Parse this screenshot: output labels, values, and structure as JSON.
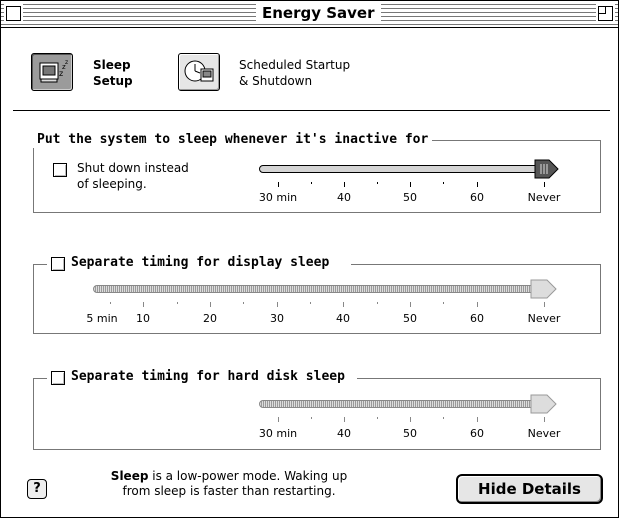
{
  "window": {
    "title": "Energy Saver"
  },
  "tabs": [
    {
      "label_line1": "Sleep",
      "label_line2": "Setup",
      "icon": "sleep-computer-icon",
      "selected": true
    },
    {
      "label_line1": "Scheduled Startup",
      "label_line2": "& Shutdown",
      "icon": "clock-computer-icon",
      "selected": false
    }
  ],
  "system_sleep": {
    "title": "Put the system to sleep whenever it's inactive for",
    "shutdown_label_line1": "Shut down instead",
    "shutdown_label_line2": "of sleeping.",
    "shutdown_checked": false,
    "tick_labels": [
      "30 min",
      "40",
      "50",
      "60",
      "Never"
    ],
    "value": "Never"
  },
  "display_sleep": {
    "title": "Separate timing for display sleep",
    "checked": false,
    "tick_labels": [
      "5 min",
      "10",
      "20",
      "30",
      "40",
      "50",
      "60",
      "Never"
    ],
    "value": "Never"
  },
  "disk_sleep": {
    "title": "Separate timing for hard disk sleep",
    "checked": false,
    "tick_labels": [
      "30 min",
      "40",
      "50",
      "60",
      "Never"
    ],
    "value": "Never"
  },
  "footer": {
    "help_symbol": "?",
    "line1_bold": "Sleep",
    "line1_rest": " is a low-power mode. Waking up",
    "line2": "from sleep is faster than restarting.",
    "button_label": "Hide Details"
  }
}
